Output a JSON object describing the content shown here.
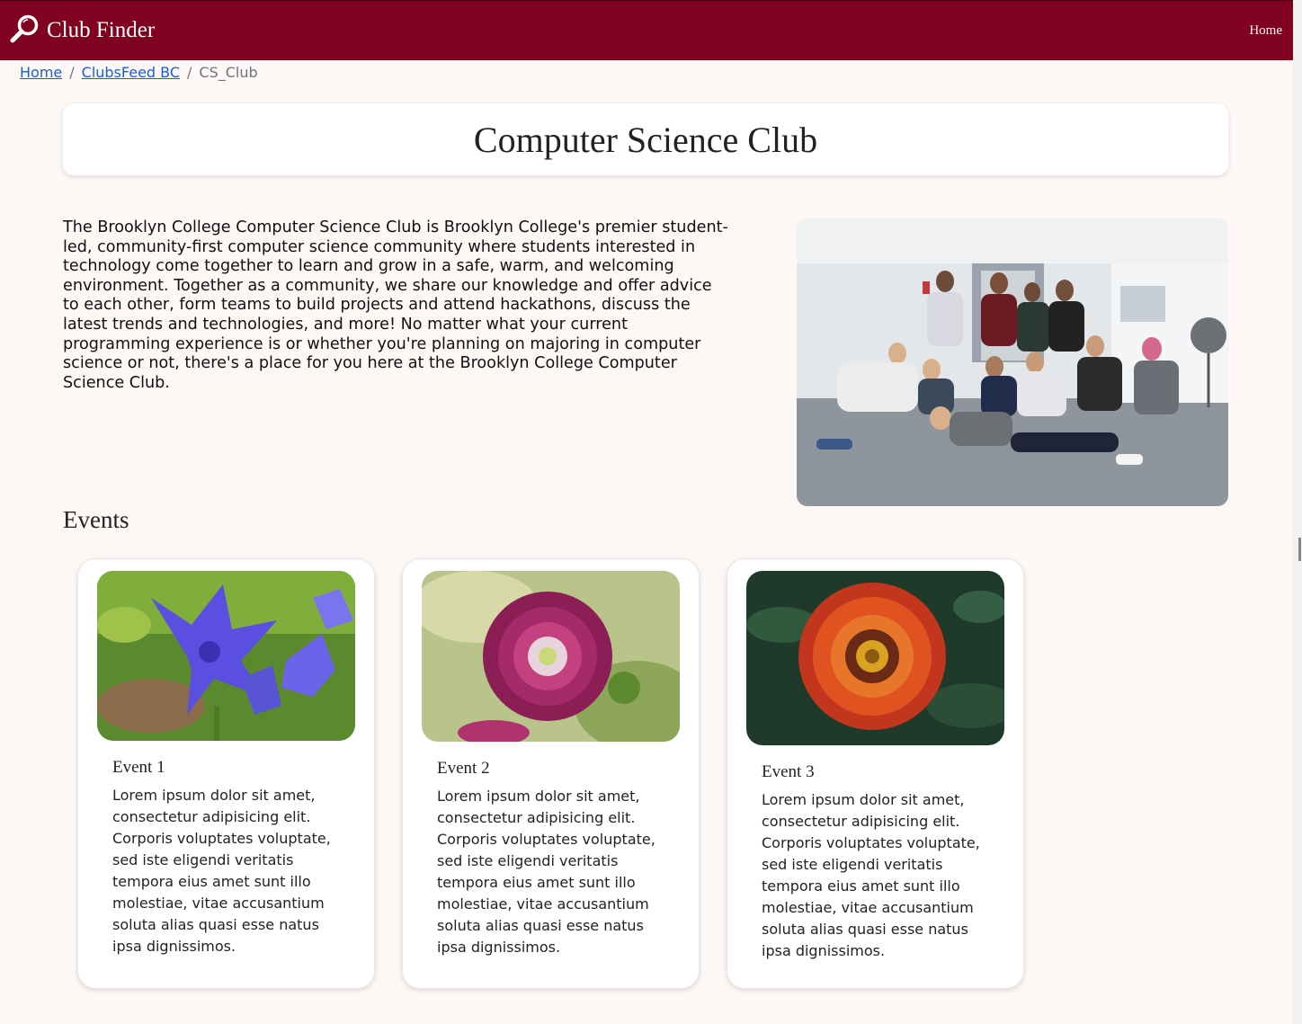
{
  "navbar": {
    "brand": "Club Finder",
    "home_link": "Home",
    "color": "#80001f"
  },
  "breadcrumb": {
    "items": [
      "Home",
      "ClubsFeed BC",
      "CS_Club"
    ]
  },
  "club": {
    "title": "Computer Science Club",
    "description": "The Brooklyn College Computer Science Club is Brooklyn College's premier student-led, community-first computer science community where students interested in technology come together to learn and grow in a safe, warm, and welcoming environment. Together as a community, we share our knowledge and offer advice to each other, form teams to build projects and attend hackathons, discuss the latest trends and technologies, and more! No matter what your current programming experience is or whether you're planning on majoring in computer science or not, there's a place for you here at the Brooklyn College Computer Science Club."
  },
  "events": {
    "heading": "Events",
    "items": [
      {
        "title": "Event 1",
        "description": "Lorem ipsum dolor sit amet, consectetur adipisicing elit. Corporis voluptates voluptate, sed iste eligendi veritatis tempora eius amet sunt illo molestiae, vitae accusantium soluta alias quasi esse natus ipsa dignissimos.",
        "image": "blue-bellflower"
      },
      {
        "title": "Event 2",
        "description": "Lorem ipsum dolor sit amet, consectetur adipisicing elit. Corporis voluptates voluptate, sed iste eligendi veritatis tempora eius amet sunt illo molestiae, vitae accusantium soluta alias quasi esse natus ipsa dignissimos.",
        "image": "purple-dahlia"
      },
      {
        "title": "Event 3",
        "description": "Lorem ipsum dolor sit amet, consectetur adipisicing elit. Corporis voluptates voluptate, sed iste eligendi veritatis tempora eius amet sunt illo molestiae, vitae accusantium soluta alias quasi esse natus ipsa dignissimos.",
        "image": "orange-gazania"
      }
    ]
  }
}
